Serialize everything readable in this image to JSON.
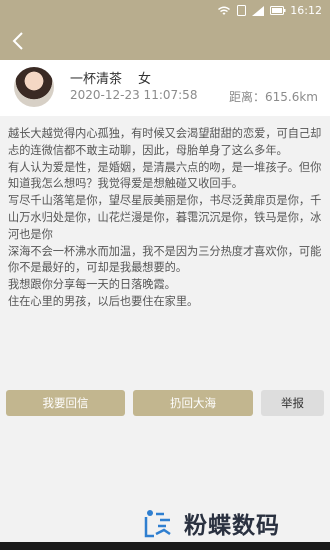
{
  "status_bar": {
    "time": "16:12"
  },
  "profile": {
    "name": "一杯清茶",
    "gender": "女",
    "timestamp": "2020-12-23 11:07:58",
    "distance_label": "距离：",
    "distance_value": "615.6km"
  },
  "letter": {
    "paragraphs": [
      "越长大越觉得内心孤独，有时候又会渴望甜甜的恋爱，可自己却忐的连微信都不敢主动聊，因此，母胎单身了这么多年。",
      "有人认为爱是性，是婚姻，是清晨六点的吻，是一堆孩子。但你知道我怎么想吗？我觉得爱是想触碰又收回手。",
      "写尽千山落笔是你，望尽星辰美丽是你，书尽泛黄扉页是你，千山万水归处是你，山花烂漫是你，暮霭沉沉是你，铁马是你，冰河也是你",
      "深海不会一杯沸水而加温，我不是因为三分热度才喜欢你，可能你不是最好的，可却是我最想要的。",
      "我想跟你分享每一天的日落晚霞。",
      "住在心里的男孩，以后也要住在家里。"
    ]
  },
  "actions": {
    "reply": "我要回信",
    "discard": "扔回大海",
    "report": "举报"
  },
  "watermark": {
    "text": "粉蝶数码"
  },
  "colors": {
    "accent": "#b8ad8e",
    "button": "#c2b68f",
    "background": "#f2f2f2"
  }
}
